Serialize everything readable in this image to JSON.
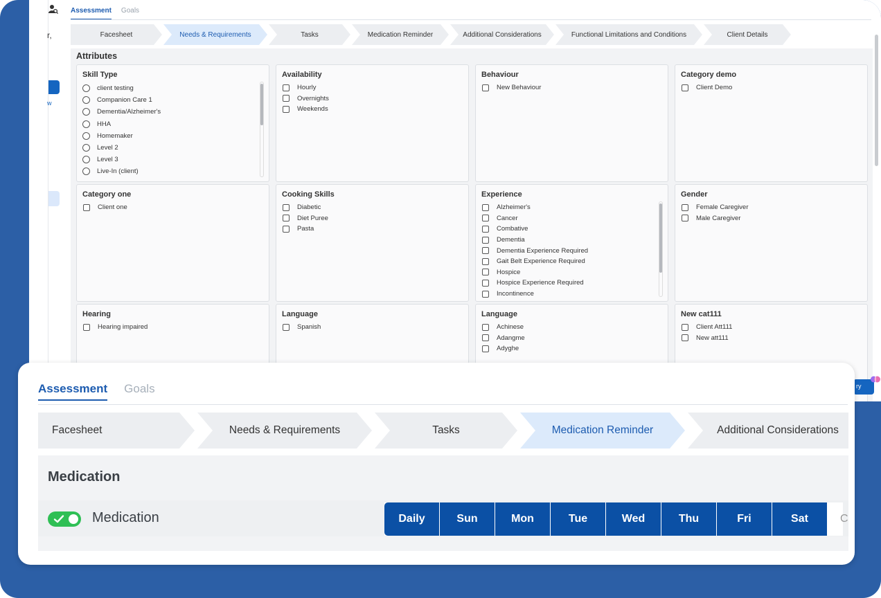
{
  "back": {
    "tabs": [
      {
        "label": "Assessment",
        "active": true
      },
      {
        "label": "Goals",
        "active": false
      }
    ],
    "steps": [
      {
        "label": "Facesheet",
        "active": false
      },
      {
        "label": "Needs & Requirements",
        "active": true
      },
      {
        "label": "Tasks",
        "active": false
      },
      {
        "label": "Medication Reminder",
        "active": false
      },
      {
        "label": "Additional Considerations",
        "active": false
      },
      {
        "label": "Functional Limitations and Conditions",
        "active": false
      },
      {
        "label": "Client Details",
        "active": false
      }
    ],
    "section_title": "Attributes",
    "left_strip": {
      "fragment": "r,",
      "link": "w"
    },
    "ai_button_fragment": "ry",
    "cards": [
      {
        "title": "Skill Type",
        "control": "radio",
        "options": [
          "client testing",
          "Companion Care 1",
          "Dementia/Alzheimer's",
          "HHA",
          "Homemaker",
          "Level 2",
          "Level 3",
          "Live-In (client)"
        ]
      },
      {
        "title": "Availability",
        "control": "checkbox",
        "options": [
          "Hourly",
          "Overnights",
          "Weekends"
        ]
      },
      {
        "title": "Behaviour",
        "control": "checkbox",
        "options": [
          "New Behaviour"
        ]
      },
      {
        "title": "Category demo",
        "control": "checkbox",
        "options": [
          "Client Demo"
        ]
      },
      {
        "title": "Category one",
        "control": "checkbox",
        "options": [
          "Client one"
        ]
      },
      {
        "title": "Cooking Skills",
        "control": "checkbox",
        "options": [
          "Diabetic",
          "Diet Puree",
          "Pasta"
        ]
      },
      {
        "title": "Experience",
        "control": "checkbox",
        "options": [
          "Alzheimer's",
          "Cancer",
          "Combative",
          "Dementia",
          "Dementia Experience Required",
          "Gait Belt Experience Required",
          "Hospice",
          "Hospice Experience Required",
          "Incontinence"
        ]
      },
      {
        "title": "Gender",
        "control": "checkbox",
        "options": [
          "Female Caregiver",
          "Male Caregiver"
        ]
      },
      {
        "title": "Hearing",
        "control": "checkbox",
        "options": [
          "Hearing impaired"
        ]
      },
      {
        "title": "Language",
        "control": "checkbox",
        "options": [
          "Spanish"
        ]
      },
      {
        "title": "Language",
        "control": "checkbox",
        "options": [
          "Achinese",
          "Adangme",
          "Adyghe"
        ]
      },
      {
        "title": "New cat111",
        "control": "checkbox",
        "options": [
          "Client Att111",
          "New att111"
        ]
      }
    ]
  },
  "front": {
    "tabs": [
      {
        "label": "Assessment",
        "active": true
      },
      {
        "label": "Goals",
        "active": false
      }
    ],
    "steps": [
      {
        "label": "Facesheet",
        "active": false
      },
      {
        "label": "Needs & Requirements",
        "active": false
      },
      {
        "label": "Tasks",
        "active": false
      },
      {
        "label": "Medication Reminder",
        "active": true
      },
      {
        "label": "Additional Considerations",
        "active": false
      }
    ],
    "heading": "Medication",
    "row_label": "Medication",
    "toggle_on": true,
    "days": [
      "Daily",
      "Sun",
      "Mon",
      "Tue",
      "Wed",
      "Thu",
      "Fri",
      "Sat"
    ],
    "day_fragment": "C"
  },
  "colors": {
    "background": "#2c5fa6",
    "accent": "#1d5cb0",
    "day_button": "#0b50a5",
    "toggle_on": "#2fbf55",
    "active_step": "#dceafb"
  }
}
